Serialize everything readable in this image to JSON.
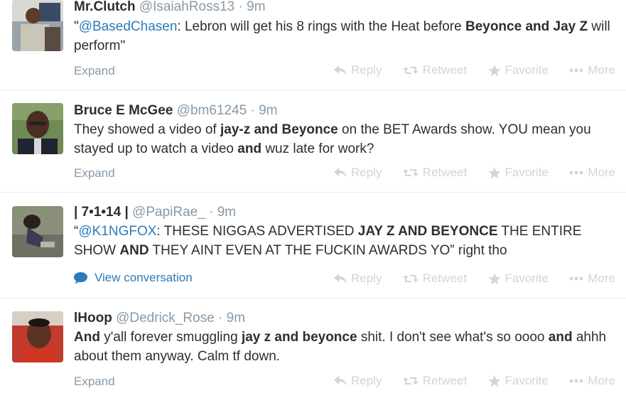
{
  "tweets": [
    {
      "name": "Mr.Clutch",
      "handle": "@IsaiahRoss13",
      "sep": "·",
      "time": "9m",
      "text": [
        {
          "t": "\"",
          "s": "plain"
        },
        {
          "t": "@BasedChasen",
          "s": "mention"
        },
        {
          "t": ": Lebron will get his 8 rings with the Heat before ",
          "s": "plain"
        },
        {
          "t": "Beyonce and Jay Z",
          "s": "bold"
        },
        {
          "t": " will perform\"",
          "s": "plain"
        }
      ],
      "footer": "Expand",
      "footer_type": "expand"
    },
    {
      "name": "Bruce E McGee",
      "handle": "@bm61245",
      "sep": "·",
      "time": "9m",
      "text": [
        {
          "t": "They showed a video of ",
          "s": "plain"
        },
        {
          "t": "jay-z and Beyonce",
          "s": "bold"
        },
        {
          "t": " on the BET Awards show. YOU mean you stayed up to watch a video ",
          "s": "plain"
        },
        {
          "t": "and",
          "s": "bold"
        },
        {
          "t": " wuz late for work?",
          "s": "plain"
        }
      ],
      "footer": "Expand",
      "footer_type": "expand"
    },
    {
      "name": "| 7•1•14 |",
      "handle": "@PapiRae_",
      "sep": "·",
      "time": "9m",
      "text": [
        {
          "t": "“",
          "s": "plain"
        },
        {
          "t": "@K1NGFOX",
          "s": "mention"
        },
        {
          "t": ": THESE NIGGAS ADVERTISED ",
          "s": "plain"
        },
        {
          "t": "JAY Z AND BEYONCE",
          "s": "bold"
        },
        {
          "t": " THE ENTIRE SHOW ",
          "s": "plain"
        },
        {
          "t": "AND",
          "s": "bold"
        },
        {
          "t": " THEY AINT EVEN AT THE FUCKIN AWARDS YO” right tho",
          "s": "plain"
        }
      ],
      "footer": "View conversation",
      "footer_type": "conversation"
    },
    {
      "name": "lHoop",
      "handle": "@Dedrick_Rose",
      "sep": "·",
      "time": "9m",
      "text": [
        {
          "t": "And",
          "s": "bold"
        },
        {
          "t": " y'all forever smuggling ",
          "s": "plain"
        },
        {
          "t": "jay z and beyonce",
          "s": "bold"
        },
        {
          "t": " shit. I don't see what's so oooo ",
          "s": "plain"
        },
        {
          "t": "and",
          "s": "bold"
        },
        {
          "t": " ahhh about them anyway. Calm tf down.",
          "s": "plain"
        }
      ],
      "footer": "Expand",
      "footer_type": "expand"
    }
  ],
  "actions": {
    "reply": "Reply",
    "retweet": "Retweet",
    "favorite": "Favorite",
    "more": "More"
  },
  "icons": {
    "reply": "reply-arrow-icon",
    "retweet": "retweet-icon",
    "favorite": "star-icon",
    "more": "ellipsis-icon",
    "conversation": "speech-bubble-icon"
  },
  "colors": {
    "name": "#292f33",
    "meta": "#8899a6",
    "mention": "#2b7bb9",
    "action": "#ccd6dd",
    "divider": "#e8e8e8"
  }
}
